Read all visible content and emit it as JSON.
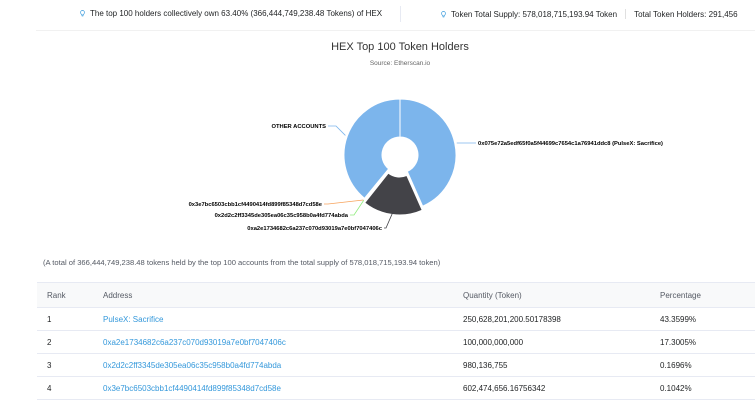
{
  "header": {
    "holders_note": "The top 100 holders collectively own 63.40% (366,444,749,238.48 Tokens) of HEX",
    "supply": "Token Total Supply: 578,018,715,193.94 Token",
    "holders_count": "Total Token Holders: 291,456",
    "bulb_color": "#77838f"
  },
  "chart_data": {
    "type": "pie",
    "title": "HEX Top 100 Token Holders",
    "subtitle": "Source: Etherscan.io",
    "series": [
      {
        "name": "0x075e72a5edf65f0a5f44699c7654c1a76941ddc8 (PulseX: Sacrifice)",
        "value": 43.3599,
        "color": "#7cb5ec"
      },
      {
        "name": "0xa2e1734682c6a237c070d93019a7e0bf7047406c",
        "value": 17.3005,
        "color": "#434348"
      },
      {
        "name": "0x2d2c2ff3345de305ea06c35c958b0a4fd774abda",
        "value": 0.1696,
        "color": "#90ed7d"
      },
      {
        "name": "0x3e7bc6503cbb1cf4490414fd899f85348d7cd58e",
        "value": 0.1042,
        "color": "#f7a35c"
      },
      {
        "name": "OTHER ACCOUNTS",
        "value": 39.0658,
        "color": "#7cb5ec"
      }
    ]
  },
  "footnote": "(A total of 366,444,749,238.48 tokens held by the top 100 accounts from the total supply of 578,018,715,193.94 token)",
  "table": {
    "headers": [
      "Rank",
      "Address",
      "Quantity (Token)",
      "Percentage"
    ],
    "rows": [
      {
        "rank": "1",
        "address": "PulseX: Sacrifice",
        "quantity": "250,628,201,200.50178398",
        "percentage": "43.3599%"
      },
      {
        "rank": "2",
        "address": "0xa2e1734682c6a237c070d93019a7e0bf7047406c",
        "quantity": "100,000,000,000",
        "percentage": "17.3005%"
      },
      {
        "rank": "3",
        "address": "0x2d2c2ff3345de305ea06c35c958b0a4fd774abda",
        "quantity": "980,136,755",
        "percentage": "0.1696%"
      },
      {
        "rank": "4",
        "address": "0x3e7bc6503cbb1cf4490414fd899f85348d7cd58e",
        "quantity": "602,474,656.16756342",
        "percentage": "0.1042%"
      }
    ]
  }
}
